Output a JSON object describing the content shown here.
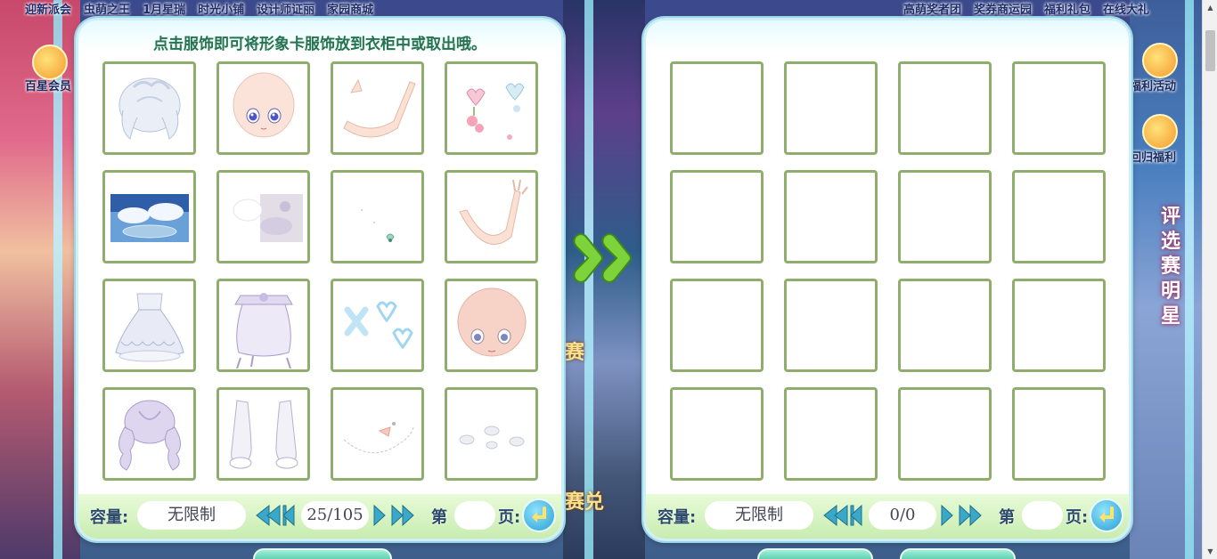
{
  "top_menu_left": [
    "迎新派会",
    "虫萌之王",
    "1月星瑞",
    "时光小铺",
    "设计师证丽",
    "家园商城"
  ],
  "top_menu_right": [
    "高萌奖者团",
    "奖券商运园",
    "福利礼包",
    "在线大礼"
  ],
  "side_labels": {
    "left": "百星会员",
    "right_top": "福利活动",
    "right_mid": "回归福利",
    "vertical_banner": "评选赛明星"
  },
  "center_background_text": [
    "赛",
    "赛兑"
  ],
  "left_panel": {
    "hint": "点击服饰即可将形象卡服饰放到衣柜中或取出哦。",
    "items": [
      {
        "icon": "white-hair-icon"
      },
      {
        "icon": "doll-face-icon"
      },
      {
        "icon": "arm-pose-icon"
      },
      {
        "icon": "heart-accessory-icon"
      },
      {
        "icon": "sky-background-icon"
      },
      {
        "icon": "flower-background-icon"
      },
      {
        "icon": "small-pendant-icon"
      },
      {
        "icon": "raised-arm-icon"
      },
      {
        "icon": "lolita-dress-icon"
      },
      {
        "icon": "lace-skirt-icon"
      },
      {
        "icon": "hearts-decoration-icon"
      },
      {
        "icon": "pink-face-icon"
      },
      {
        "icon": "lavender-curly-hair-icon"
      },
      {
        "icon": "white-boots-icon"
      },
      {
        "icon": "chain-accessory-icon"
      },
      {
        "icon": "cloud-ornament-icon"
      }
    ],
    "footer": {
      "capacity_label": "容量:",
      "capacity_value": "无限制",
      "page_display": "25/105",
      "page_prefix": "第",
      "page_suffix": "页:",
      "page_input_value": ""
    }
  },
  "right_panel": {
    "hint": "",
    "slot_count": 16,
    "footer": {
      "capacity_label": "容量:",
      "capacity_value": "无限制",
      "page_display": "0/0",
      "page_prefix": "第",
      "page_suffix": "页:",
      "page_input_value": ""
    }
  },
  "colors": {
    "slot_border": "#8fae6e",
    "hint_text": "#2a6f5a",
    "footer_bg": "#d8f4c8",
    "arrow_green": "#7ed23a",
    "nav_arrow": "#3aa8c8"
  }
}
